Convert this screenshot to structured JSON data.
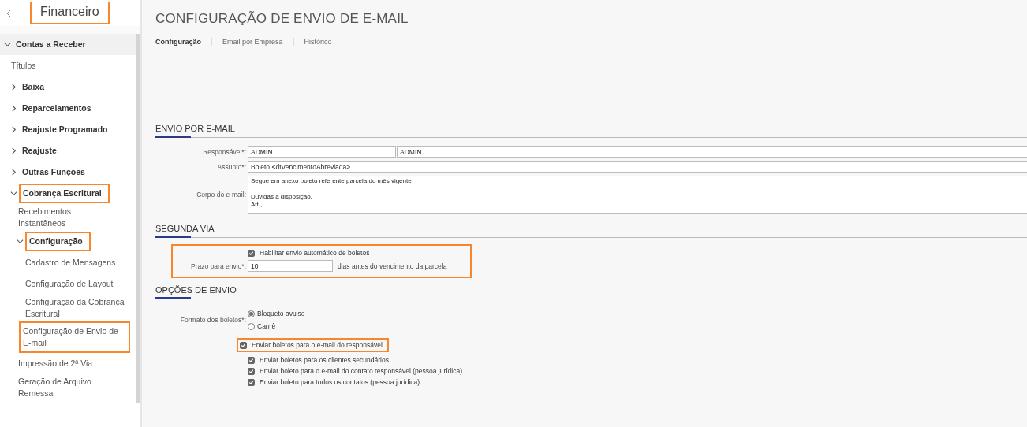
{
  "sidebar": {
    "title": "Financeiro",
    "title_highlighted": true,
    "items": [
      {
        "kind": "group",
        "label": "Contas a Receber",
        "expanded": true,
        "highlighted": false,
        "children": [
          {
            "kind": "link",
            "label": "Títulos",
            "highlighted": false
          },
          {
            "kind": "group",
            "label": "Baixa",
            "expanded": false,
            "highlighted": false
          },
          {
            "kind": "group",
            "label": "Reparcelamentos",
            "expanded": false,
            "highlighted": false
          },
          {
            "kind": "group",
            "label": "Reajuste Programado",
            "expanded": false,
            "highlighted": false
          },
          {
            "kind": "group",
            "label": "Reajuste",
            "expanded": false,
            "highlighted": false
          },
          {
            "kind": "group",
            "label": "Outras Funções",
            "expanded": false,
            "highlighted": false
          },
          {
            "kind": "group",
            "label": "Cobrança Escritural",
            "expanded": true,
            "highlighted": true,
            "children": [
              {
                "kind": "link",
                "label": "Recebimentos Instantâneos",
                "highlighted": false
              },
              {
                "kind": "group",
                "label": "Configuração",
                "expanded": true,
                "highlighted": true,
                "children": [
                  {
                    "kind": "link",
                    "label": "Cadastro de Mensagens",
                    "highlighted": false
                  },
                  {
                    "kind": "link",
                    "label": "Configuração de Layout",
                    "highlighted": false
                  },
                  {
                    "kind": "link",
                    "label": "Configuração da Cobrança Escritural",
                    "highlighted": false
                  },
                  {
                    "kind": "link",
                    "label": "Configuração de Envio de E-mail",
                    "highlighted": true
                  }
                ]
              },
              {
                "kind": "link",
                "label": "Impressão de 2ª Via",
                "highlighted": false
              },
              {
                "kind": "link",
                "label": "Geração de Arquivo Remessa",
                "highlighted": false
              }
            ]
          }
        ]
      }
    ]
  },
  "page": {
    "title": "CONFIGURAÇÃO DE ENVIO DE E-MAIL",
    "tabs": [
      {
        "label": "Configuração",
        "selected": true
      },
      {
        "label": "Email por Empresa",
        "selected": false
      },
      {
        "label": "Histórico",
        "selected": false
      }
    ]
  },
  "sections": [
    {
      "title": "ENVIO POR E-MAIL",
      "groups": [
        {
          "highlighted": false,
          "rows": [
            {
              "kind": "inputs",
              "label": "Responsável*:",
              "values": [
                "ADMIN",
                "ADMIN"
              ]
            },
            {
              "kind": "inputs",
              "label": "Assunto*:",
              "values": [
                "Boleto <dtVencimentoAbreviada>"
              ]
            },
            {
              "kind": "textarea",
              "label": "Corpo do e-mail:",
              "value": "Segue em anexo boleto referente parcela do mês vigente\n\nDúvidas a disposição.\nAtt.,"
            }
          ]
        }
      ]
    },
    {
      "title": "SEGUNDA VIA",
      "groups": [
        {
          "highlighted": true,
          "rows": [
            {
              "kind": "checkbox",
              "label": "Habilitar envio automático de boletos",
              "checked": true
            },
            {
              "kind": "input",
              "label": "Prazo para envio*:",
              "value": "10",
              "suffix": "dias antes do vencimento da parcela"
            }
          ]
        }
      ]
    },
    {
      "title": "OPÇÕES DE ENVIO",
      "groups": [
        {
          "highlighted": false,
          "rows": [
            {
              "kind": "radio",
              "label": "Formato dos boletos*:",
              "options": [
                {
                  "label": "Bloqueto avulso",
                  "selected": true
                },
                {
                  "label": "Carnê",
                  "selected": false
                }
              ]
            }
          ]
        },
        {
          "highlighted": true,
          "rows": [
            {
              "kind": "checkbox",
              "label": "Enviar boletos para o e-mail do responsável",
              "checked": true
            }
          ]
        },
        {
          "highlighted": false,
          "rows": [
            {
              "kind": "checkbox",
              "label": "Enviar boletos para os clientes secundários",
              "checked": true
            },
            {
              "kind": "checkbox",
              "label": "Enviar boleto para o e-mail do contato responsável (pessoa jurídica)",
              "checked": true
            },
            {
              "kind": "checkbox",
              "label": "Enviar boleto para todos os contatos (pessoa jurídica)",
              "checked": true
            }
          ]
        }
      ]
    }
  ]
}
